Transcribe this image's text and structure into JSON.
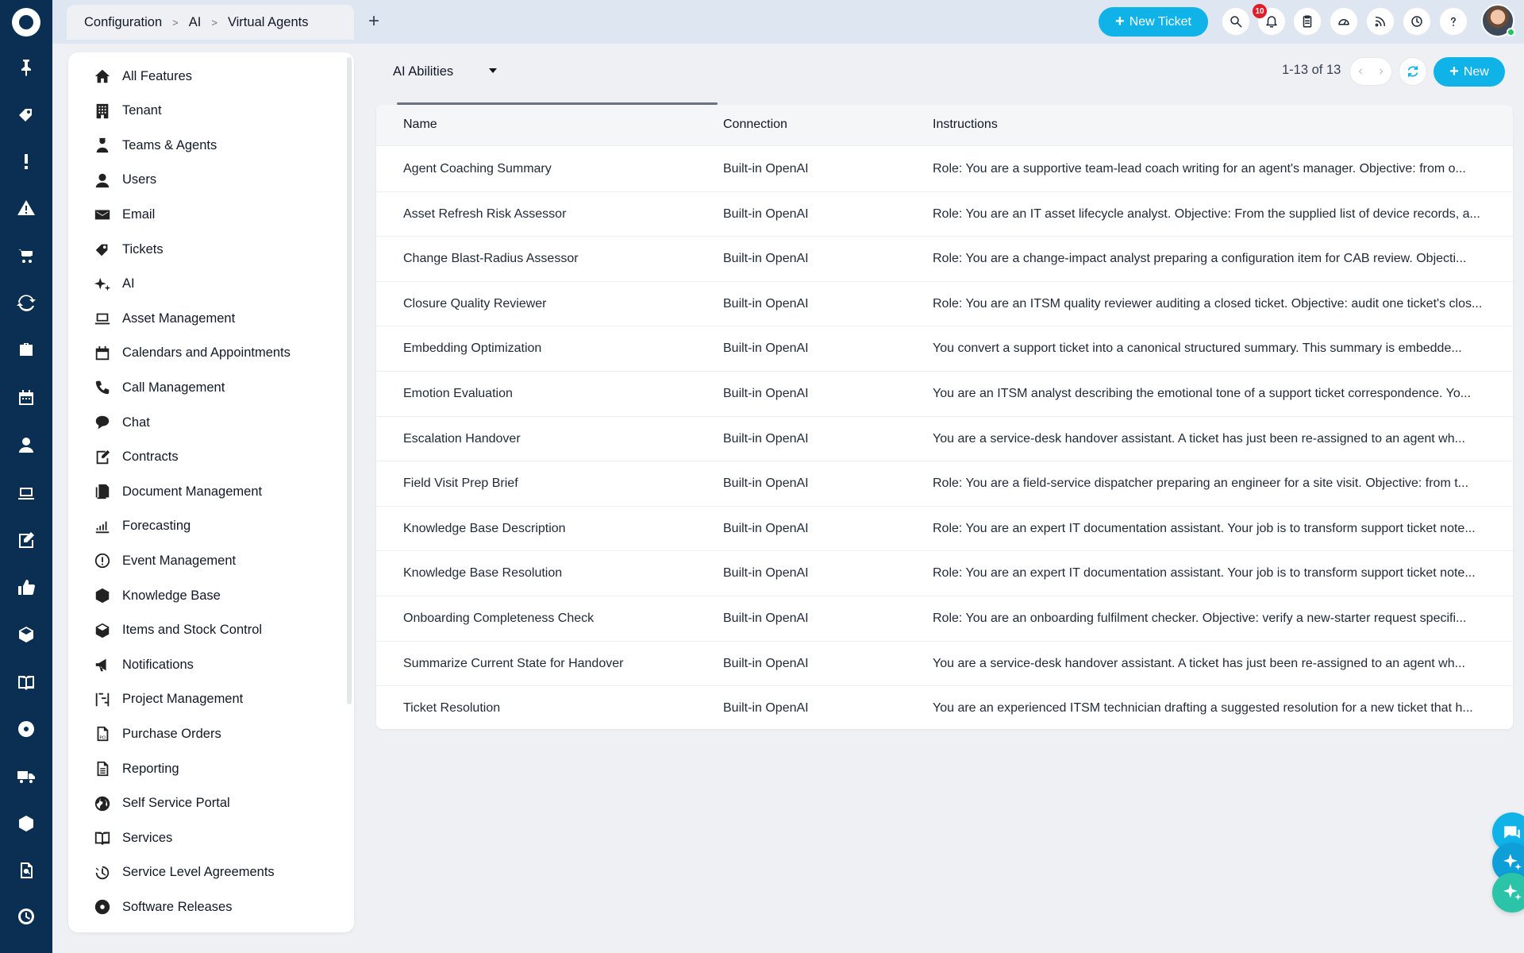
{
  "breadcrumb": [
    "Configuration",
    "AI",
    "Virtual Agents"
  ],
  "header": {
    "new_ticket_label": "New Ticket",
    "notification_count": "10"
  },
  "rail_icons": [
    "logo-icon",
    "pin-icon",
    "tag-icon",
    "alert-icon",
    "warning-icon",
    "cart-icon",
    "sync-icon",
    "briefcase-icon",
    "calendar-icon",
    "user-icon",
    "laptop-icon",
    "edit-icon",
    "thumbs-up-icon",
    "box-icon",
    "book-icon",
    "disc-icon",
    "truck-icon",
    "package-icon",
    "file-search-icon",
    "clock-icon"
  ],
  "menu": {
    "items": [
      {
        "label": "All Features",
        "icon": "home-icon"
      },
      {
        "label": "Tenant",
        "icon": "building-icon"
      },
      {
        "label": "Teams & Agents",
        "icon": "agent-icon"
      },
      {
        "label": "Users",
        "icon": "user-icon"
      },
      {
        "label": "Email",
        "icon": "envelope-icon"
      },
      {
        "label": "Tickets",
        "icon": "tag-icon"
      },
      {
        "label": "AI",
        "icon": "sparkles-icon"
      },
      {
        "label": "Asset Management",
        "icon": "laptop-icon"
      },
      {
        "label": "Calendars and Appointments",
        "icon": "calendar-icon"
      },
      {
        "label": "Call Management",
        "icon": "phone-icon"
      },
      {
        "label": "Chat",
        "icon": "chat-icon"
      },
      {
        "label": "Contracts",
        "icon": "contract-icon"
      },
      {
        "label": "Document Management",
        "icon": "documents-icon"
      },
      {
        "label": "Forecasting",
        "icon": "chart-icon"
      },
      {
        "label": "Event Management",
        "icon": "exclamation-circle-icon"
      },
      {
        "label": "Knowledge Base",
        "icon": "knowledge-icon"
      },
      {
        "label": "Items and Stock Control",
        "icon": "box-icon"
      },
      {
        "label": "Notifications",
        "icon": "megaphone-icon"
      },
      {
        "label": "Project Management",
        "icon": "project-icon"
      },
      {
        "label": "Purchase Orders",
        "icon": "po-icon"
      },
      {
        "label": "Reporting",
        "icon": "report-icon"
      },
      {
        "label": "Self Service Portal",
        "icon": "globe-icon"
      },
      {
        "label": "Services",
        "icon": "book-icon"
      },
      {
        "label": "Service Level Agreements",
        "icon": "timer-icon"
      },
      {
        "label": "Software Releases",
        "icon": "disc-icon"
      }
    ]
  },
  "toolbar": {
    "selected": "AI Abilities",
    "pager_text": "1-13 of 13",
    "new_label": "New"
  },
  "table": {
    "headers": [
      "Name",
      "Connection",
      "Instructions"
    ],
    "rows": [
      {
        "name": "Agent Coaching Summary",
        "connection": "Built-in OpenAI",
        "instructions": "Role: You are a supportive team-lead coach writing for an agent's manager. Objective: from o..."
      },
      {
        "name": "Asset Refresh Risk Assessor",
        "connection": "Built-in OpenAI",
        "instructions": "Role: You are an IT asset lifecycle analyst. Objective: From the supplied list of device records, a..."
      },
      {
        "name": "Change Blast-Radius Assessor",
        "connection": "Built-in OpenAI",
        "instructions": "Role: You are a change-impact analyst preparing a configuration item for CAB review. Objecti..."
      },
      {
        "name": "Closure Quality Reviewer",
        "connection": "Built-in OpenAI",
        "instructions": "Role: You are an ITSM quality reviewer auditing a closed ticket. Objective: audit one ticket's clos..."
      },
      {
        "name": "Embedding Optimization",
        "connection": "Built-in OpenAI",
        "instructions": "You convert a support ticket into a canonical structured summary. This summary is embedde..."
      },
      {
        "name": "Emotion Evaluation",
        "connection": "Built-in OpenAI",
        "instructions": "You are an ITSM analyst describing the emotional tone of a support ticket correspondence. Yo..."
      },
      {
        "name": "Escalation Handover",
        "connection": "Built-in OpenAI",
        "instructions": "You are a service-desk handover assistant. A ticket has just been re-assigned to an agent wh..."
      },
      {
        "name": "Field Visit Prep Brief",
        "connection": "Built-in OpenAI",
        "instructions": "Role: You are a field-service dispatcher preparing an engineer for a site visit. Objective: from t..."
      },
      {
        "name": "Knowledge Base Description",
        "connection": "Built-in OpenAI",
        "instructions": "Role: You are an expert IT documentation assistant. Your job is to transform support ticket note..."
      },
      {
        "name": "Knowledge Base Resolution",
        "connection": "Built-in OpenAI",
        "instructions": "Role: You are an expert IT documentation assistant. Your job is to transform support ticket note..."
      },
      {
        "name": "Onboarding Completeness Check",
        "connection": "Built-in OpenAI",
        "instructions": "Role: You are an onboarding fulfilment checker. Objective: verify a new-starter request specifi..."
      },
      {
        "name": "Summarize Current State for Handover",
        "connection": "Built-in OpenAI",
        "instructions": "You are a service-desk handover assistant. A ticket has just been re-assigned to an agent wh..."
      },
      {
        "name": "Ticket Resolution",
        "connection": "Built-in OpenAI",
        "instructions": "You are an experienced ITSM technician drafting a suggested resolution for a new ticket that h..."
      }
    ]
  },
  "colors": {
    "rail": "#0b2f52",
    "accent": "#10b3e8",
    "badge": "#e11d2a"
  }
}
